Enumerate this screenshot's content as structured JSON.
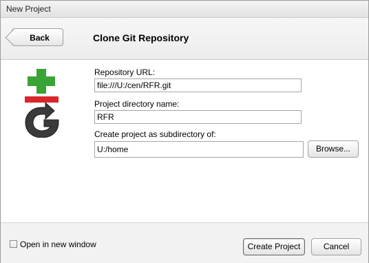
{
  "window": {
    "title": "New Project"
  },
  "header": {
    "back_label": "Back",
    "title": "Clone Git Repository"
  },
  "form": {
    "repo_url_label": "Repository URL:",
    "repo_url_value": "file:///U:/cen/RFR.git",
    "dir_name_label": "Project directory name:",
    "dir_name_value": "RFR",
    "subdir_label": "Create project as subdirectory of:",
    "subdir_value": "U:/home",
    "browse_label": "Browse..."
  },
  "footer": {
    "open_new_window_label": "Open in new window",
    "open_new_window_checked": false,
    "create_label": "Create Project",
    "cancel_label": "Cancel"
  },
  "colors": {
    "git_plus": "#3aa335",
    "git_minus": "#d9262c",
    "git_logo_body": "#3a3a3a"
  }
}
